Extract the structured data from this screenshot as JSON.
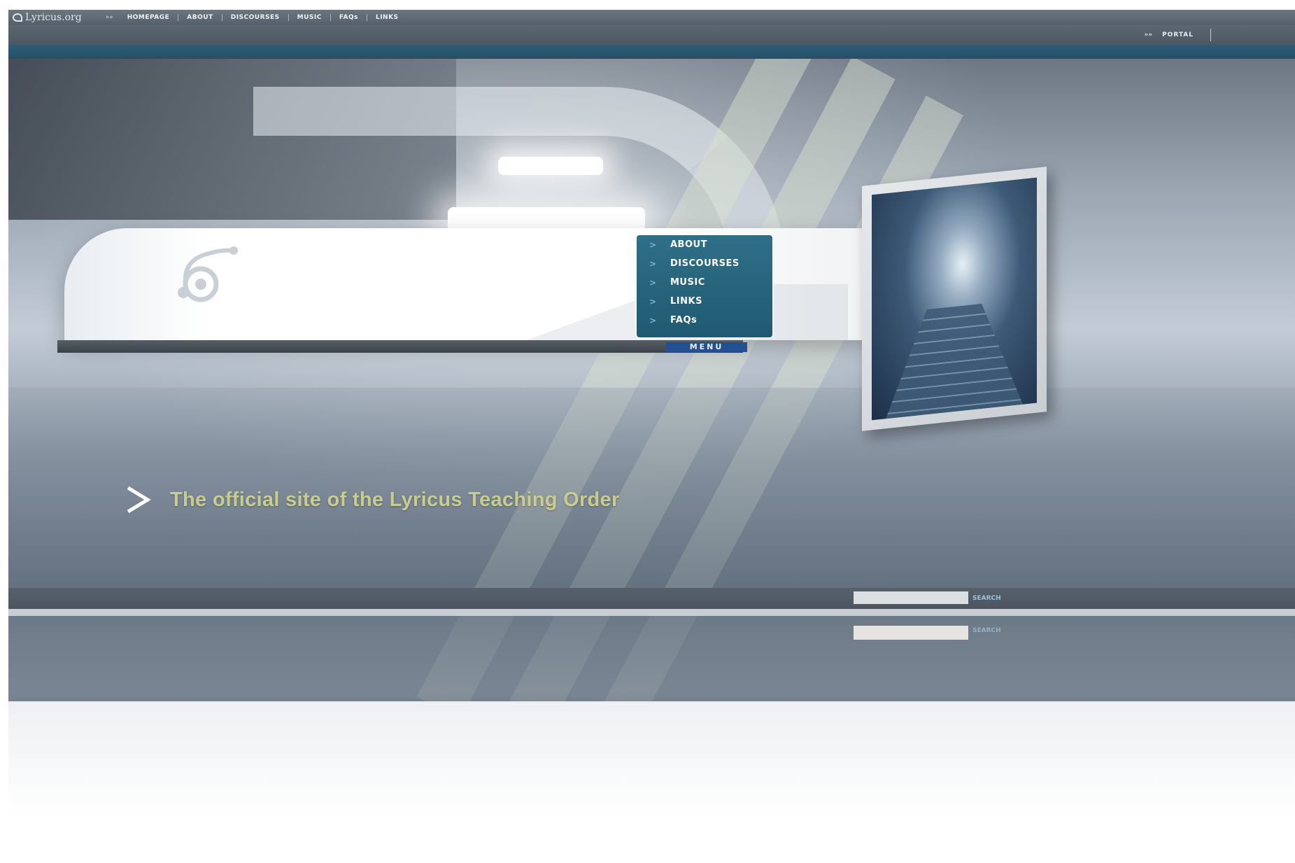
{
  "site": {
    "logo_text": "Lyricus.org"
  },
  "top_nav": {
    "lead": "»»",
    "items": [
      "HOMEPAGE",
      "ABOUT",
      "DISCOURSES",
      "MUSIC",
      "FAQs",
      "LINKS"
    ]
  },
  "secondary_nav": {
    "arrow": "»»",
    "portal_label": "PORTAL"
  },
  "menu": {
    "items": [
      "ABOUT",
      "DISCOURSES",
      "MUSIC",
      "LINKS",
      "FAQs"
    ],
    "arrow": ">",
    "label": "MENU"
  },
  "tagline": "The official site of the Lyricus Teaching Order",
  "search": {
    "button_label": "SEARCH"
  },
  "colors": {
    "nav_bar": "#56606a",
    "blue_strip": "#2f5c7a",
    "menu_panel": "#2a6a82",
    "menu_label_bg": "#244f93",
    "tagline": "#c8cc8e"
  }
}
